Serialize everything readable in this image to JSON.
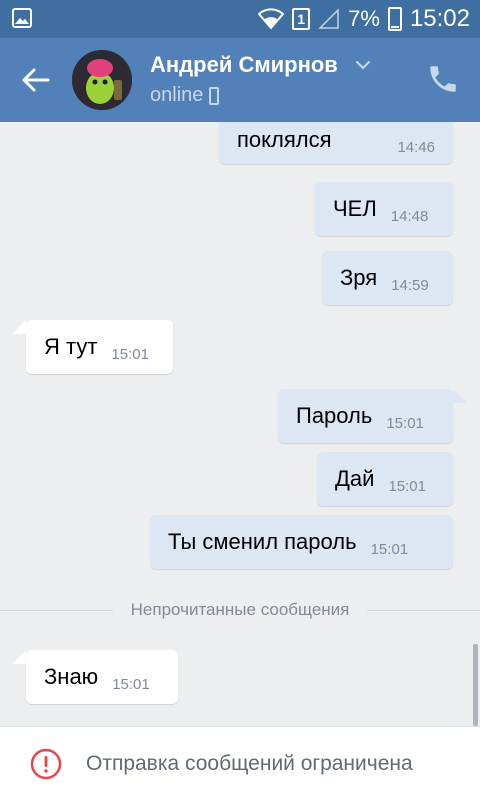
{
  "status_bar": {
    "battery": "7%",
    "time": "15:02",
    "sim": "1",
    "icons": [
      "image-icon",
      "wifi-icon",
      "sim-icon",
      "signal-icon",
      "battery-icon"
    ]
  },
  "header": {
    "name": "Андрей Смирнов",
    "status": "online",
    "icons": [
      "back-arrow-icon",
      "chevron-down-icon",
      "mobile-icon",
      "phone-icon"
    ]
  },
  "messages": [
    {
      "dir": "out",
      "text": "поклялся",
      "time": "14:46"
    },
    {
      "dir": "out",
      "text": "ЧЕЛ",
      "time": "14:48"
    },
    {
      "dir": "out",
      "text": "Зря",
      "time": "14:59"
    },
    {
      "dir": "in",
      "text": "Я тут",
      "time": "15:01"
    },
    {
      "dir": "out",
      "text": "Пароль",
      "time": "15:01"
    },
    {
      "dir": "out",
      "text": "Дай",
      "time": "15:01"
    },
    {
      "dir": "out",
      "text": "Ты сменил пароль",
      "time": "15:01"
    },
    {
      "dir": "in",
      "text": "Знаю",
      "time": "15:01"
    }
  ],
  "unread_separator": "Непрочитанные сообщения",
  "bottom": {
    "text": "Отправка сообщений ограничена",
    "icon": "alert-circle-icon"
  },
  "colors": {
    "status_bar": "#3f6ea0",
    "header": "#5181b8",
    "background": "#edeef0",
    "outgoing_bubble": "#dde6f3",
    "incoming_bubble": "#ffffff",
    "alert": "#e64646"
  }
}
